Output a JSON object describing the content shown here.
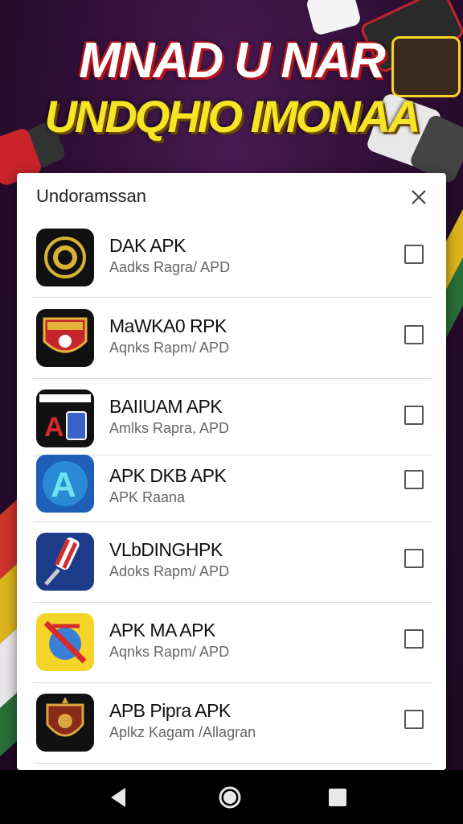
{
  "banner": {
    "line1": "MNAD U NAR",
    "line2": "UNDQHIO IMONAA"
  },
  "dialog": {
    "title": "Undoramssan",
    "items": [
      {
        "name": "DAK APK",
        "subtitle": "Aadks Ragra/ APD",
        "icon": "laurel-badge-icon",
        "checked": false
      },
      {
        "name": "MaWKA0 RPK",
        "subtitle": "Aqnks Rapm/ APD",
        "icon": "red-shield-icon",
        "checked": false
      },
      {
        "name": "BAIIUAM APK",
        "subtitle": "Amlks Rapra, APD",
        "icon": "ab-store-icon",
        "checked": false
      },
      {
        "name": "APK DKB APK",
        "subtitle": "APK Raana",
        "icon": "blue-a-icon",
        "checked": false
      },
      {
        "name": "VLbDINGHPK",
        "subtitle": "Adoks Rapm/ APD",
        "icon": "brush-icon",
        "checked": false
      },
      {
        "name": "APK MA APK",
        "subtitle": "Aqnks Rapm/ APD",
        "icon": "crossed-globe-icon",
        "checked": false
      },
      {
        "name": "APB Pipra APK",
        "subtitle": "Aplkz Kagam /Allagran",
        "icon": "crest-shield-icon",
        "checked": false
      }
    ]
  },
  "colors": {
    "background": "#2c0d33",
    "banner_red": "#b5141c",
    "banner_yellow": "#f5e526",
    "dialog_bg": "#ffffff"
  },
  "navbar": {
    "back": "back-icon",
    "home": "home-icon",
    "recents": "recents-icon"
  }
}
